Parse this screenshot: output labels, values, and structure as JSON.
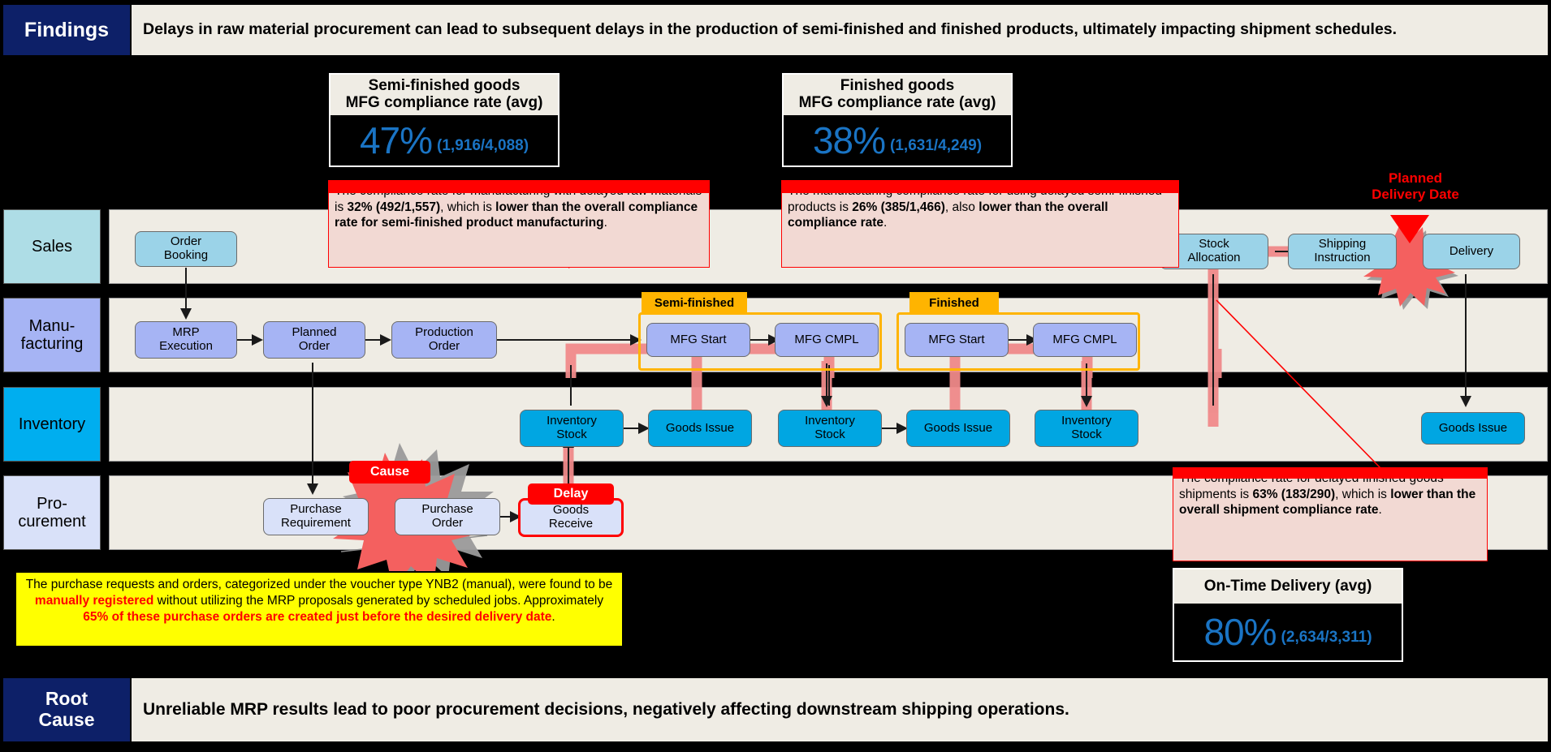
{
  "header": {
    "tag": "Findings",
    "text": "Delays in raw material procurement can lead to subsequent delays in the production of semi-finished and finished products, ultimately impacting shipment schedules."
  },
  "footer": {
    "tag_line1": "Root",
    "tag_line2": "Cause",
    "text": "Unreliable MRP results lead to poor procurement decisions, negatively affecting downstream shipping operations."
  },
  "kpis": [
    {
      "id": "semi-finished-mfg-compliance",
      "title_line1": "Semi-finished goods",
      "title_line2": "MFG compliance rate (avg)",
      "value": "47%",
      "fraction": "(1,916/4,088)"
    },
    {
      "id": "finished-mfg-compliance",
      "title_line1": "Finished goods",
      "title_line2": "MFG compliance rate (avg)",
      "value": "38%",
      "fraction": "(1,631/4,249)"
    },
    {
      "id": "on-time-delivery",
      "title_line1": "On-Time Delivery (avg)",
      "title_line2": "",
      "value": "80%",
      "fraction": "(2,634/3,311)"
    }
  ],
  "lanes": [
    {
      "id": "sales",
      "label": "Sales",
      "color": "#aedde6"
    },
    {
      "id": "manufacturing",
      "label": "Manu-\nfacturing",
      "color": "#a6b4f4"
    },
    {
      "id": "inventory",
      "label": "Inventory",
      "color": "#00aeef"
    },
    {
      "id": "procurement",
      "label": "Pro-\ncurement",
      "color": "#d9e1f9"
    }
  ],
  "nodes": {
    "order_booking": "Order\nBooking",
    "stock_allocation": "Stock\nAllocation",
    "shipping_instruction": "Shipping\nInstruction",
    "delivery": "Delivery",
    "mrp_execution": "MRP\nExecution",
    "planned_order": "Planned\nOrder",
    "production_order": "Production\nOrder",
    "sf_mfg_start": "MFG Start",
    "sf_mfg_cmpl": "MFG CMPL",
    "fg_mfg_start": "MFG Start",
    "fg_mfg_cmpl": "MFG CMPL",
    "inv_stock_1": "Inventory\nStock",
    "goods_issue_1": "Goods Issue",
    "inv_stock_2": "Inventory\nStock",
    "goods_issue_2": "Goods Issue",
    "inv_stock_3": "Inventory\nStock",
    "goods_issue_3": "Goods Issue",
    "purchase_requirement": "Purchase\nRequirement",
    "purchase_order": "Purchase\nOrder",
    "goods_receive": "Goods\nReceive"
  },
  "groups": {
    "semi_finished": "Semi-finished",
    "finished": "Finished"
  },
  "badges": {
    "cause": "Cause",
    "delay": "Delay",
    "planned_delivery_date": "Planned\nDelivery Date"
  },
  "callouts": {
    "semi_finished_compliance": {
      "parts": [
        {
          "t": "The compliance rate for manufacturing with delayed raw materials is ",
          "b": false
        },
        {
          "t": "32% (492/1,557)",
          "b": true
        },
        {
          "t": ", which is ",
          "b": false
        },
        {
          "t": "lower than the overall compliance rate for semi-finished product manufacturing",
          "b": true
        },
        {
          "t": ".",
          "b": false
        }
      ]
    },
    "finished_compliance": {
      "parts": [
        {
          "t": "The manufacturing compliance rate for using delayed semi-finished products is ",
          "b": false
        },
        {
          "t": "26% (385/1,466)",
          "b": true
        },
        {
          "t": ", also ",
          "b": false
        },
        {
          "t": "lower than the overall compliance rate",
          "b": true
        },
        {
          "t": ".",
          "b": false
        }
      ]
    },
    "shipment_compliance": {
      "parts": [
        {
          "t": "The compliance rate for delayed finished goods shipments is ",
          "b": false
        },
        {
          "t": "63% (183/290)",
          "b": true
        },
        {
          "t": ", which is ",
          "b": false
        },
        {
          "t": "lower than the overall shipment compliance rate",
          "b": true
        },
        {
          "t": ".",
          "b": false
        }
      ]
    }
  },
  "yellow_callout": {
    "parts": [
      {
        "t": "The purchase requests and orders, categorized under the voucher type YNB2 (manual), were found to be ",
        "hi": false
      },
      {
        "t": "manually registered",
        "hi": true
      },
      {
        "t": " without utilizing the MRP proposals generated by scheduled jobs. Approximately ",
        "hi": false
      },
      {
        "t": "65% of these purchase orders are created just before the desired delivery date",
        "hi": true
      },
      {
        "t": ".",
        "hi": false
      }
    ]
  },
  "colors": {
    "brand_navy": "#0d2068",
    "paper": "#efece4",
    "accent_blue": "#1a74c4",
    "alert_red": "#ff0000",
    "group_amber": "#ffb400",
    "highlight_path": "#f08a8a"
  }
}
